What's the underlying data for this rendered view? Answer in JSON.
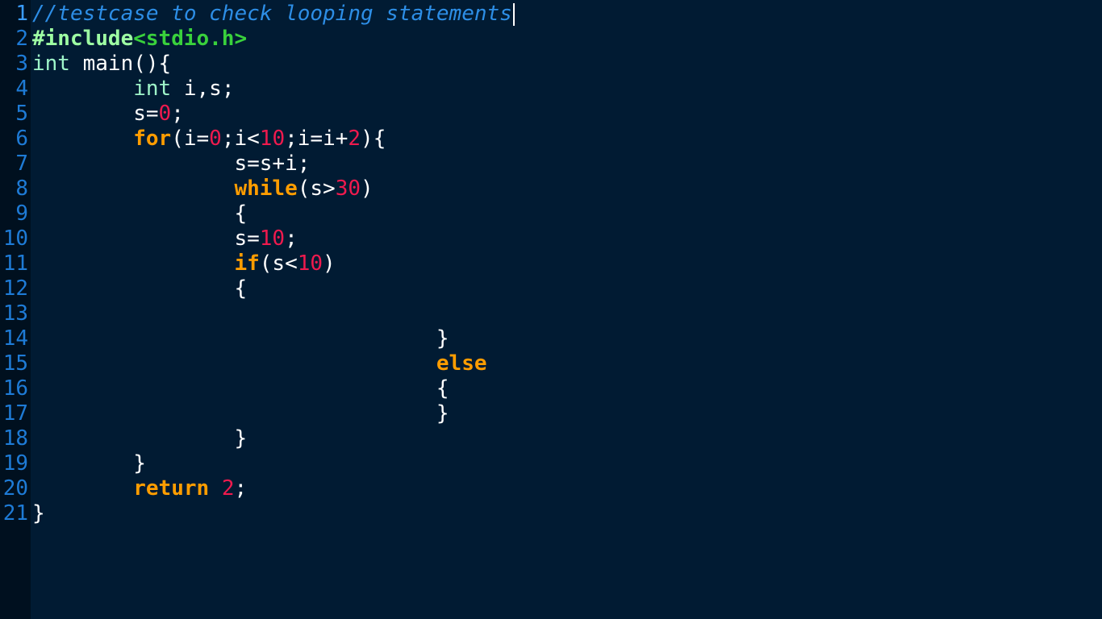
{
  "editor": {
    "lines": [
      {
        "num": "1",
        "indent": "",
        "tokens": [
          {
            "t": "comment",
            "v": "//testcase to check looping statements"
          }
        ],
        "cursor": true
      },
      {
        "num": "2",
        "indent": "",
        "tokens": [
          {
            "t": "pre",
            "v": "#include"
          },
          {
            "t": "inc",
            "v": "<stdio.h>"
          }
        ]
      },
      {
        "num": "3",
        "indent": "",
        "tokens": [
          {
            "t": "type",
            "v": "int"
          },
          {
            "t": "plain",
            "v": " main(){"
          }
        ]
      },
      {
        "num": "4",
        "indent": "        ",
        "tokens": [
          {
            "t": "type",
            "v": "int"
          },
          {
            "t": "plain",
            "v": " i,s;"
          }
        ]
      },
      {
        "num": "5",
        "indent": "        ",
        "tokens": [
          {
            "t": "plain",
            "v": "s="
          },
          {
            "t": "num",
            "v": "0"
          },
          {
            "t": "plain",
            "v": ";"
          }
        ]
      },
      {
        "num": "6",
        "indent": "        ",
        "tokens": [
          {
            "t": "kw",
            "v": "for"
          },
          {
            "t": "plain",
            "v": "(i="
          },
          {
            "t": "num",
            "v": "0"
          },
          {
            "t": "plain",
            "v": ";i<"
          },
          {
            "t": "num",
            "v": "10"
          },
          {
            "t": "plain",
            "v": ";i=i+"
          },
          {
            "t": "num",
            "v": "2"
          },
          {
            "t": "plain",
            "v": "){"
          }
        ]
      },
      {
        "num": "7",
        "indent": "                ",
        "tokens": [
          {
            "t": "plain",
            "v": "s=s+i;"
          }
        ]
      },
      {
        "num": "8",
        "indent": "                ",
        "tokens": [
          {
            "t": "kw",
            "v": "while"
          },
          {
            "t": "plain",
            "v": "(s>"
          },
          {
            "t": "num",
            "v": "30"
          },
          {
            "t": "plain",
            "v": ")"
          }
        ]
      },
      {
        "num": "9",
        "indent": "                ",
        "tokens": [
          {
            "t": "plain",
            "v": "{"
          }
        ]
      },
      {
        "num": "10",
        "indent": "                ",
        "tokens": [
          {
            "t": "plain",
            "v": "s="
          },
          {
            "t": "num",
            "v": "10"
          },
          {
            "t": "plain",
            "v": ";"
          }
        ]
      },
      {
        "num": "11",
        "indent": "                ",
        "tokens": [
          {
            "t": "kw",
            "v": "if"
          },
          {
            "t": "plain",
            "v": "(s<"
          },
          {
            "t": "num",
            "v": "10"
          },
          {
            "t": "plain",
            "v": ")"
          }
        ]
      },
      {
        "num": "12",
        "indent": "                ",
        "tokens": [
          {
            "t": "plain",
            "v": "{"
          }
        ]
      },
      {
        "num": "13",
        "indent": "",
        "tokens": []
      },
      {
        "num": "14",
        "indent": "                                ",
        "tokens": [
          {
            "t": "plain",
            "v": "}"
          }
        ]
      },
      {
        "num": "15",
        "indent": "                                ",
        "tokens": [
          {
            "t": "kw",
            "v": "else"
          }
        ]
      },
      {
        "num": "16",
        "indent": "                                ",
        "tokens": [
          {
            "t": "plain",
            "v": "{"
          }
        ]
      },
      {
        "num": "17",
        "indent": "                                ",
        "tokens": [
          {
            "t": "plain",
            "v": "}"
          }
        ]
      },
      {
        "num": "18",
        "indent": "                ",
        "tokens": [
          {
            "t": "plain",
            "v": "}"
          }
        ]
      },
      {
        "num": "19",
        "indent": "        ",
        "tokens": [
          {
            "t": "plain",
            "v": "}"
          }
        ]
      },
      {
        "num": "20",
        "indent": "        ",
        "tokens": [
          {
            "t": "kw",
            "v": "return"
          },
          {
            "t": "plain",
            "v": " "
          },
          {
            "t": "num",
            "v": "2"
          },
          {
            "t": "plain",
            "v": ";"
          }
        ]
      },
      {
        "num": "21",
        "indent": "",
        "tokens": [
          {
            "t": "plain",
            "v": "}"
          }
        ]
      }
    ]
  },
  "colors": {
    "background": "#011b33",
    "gutter": "#00101f",
    "line_number": "#1e7bd6",
    "comment": "#2d8ee6",
    "preprocessor": "#9effa3",
    "include": "#39d13c",
    "type": "#9ff5c9",
    "keyword": "#ff9d00",
    "number": "#ef1a4e",
    "text": "#ffffff"
  }
}
